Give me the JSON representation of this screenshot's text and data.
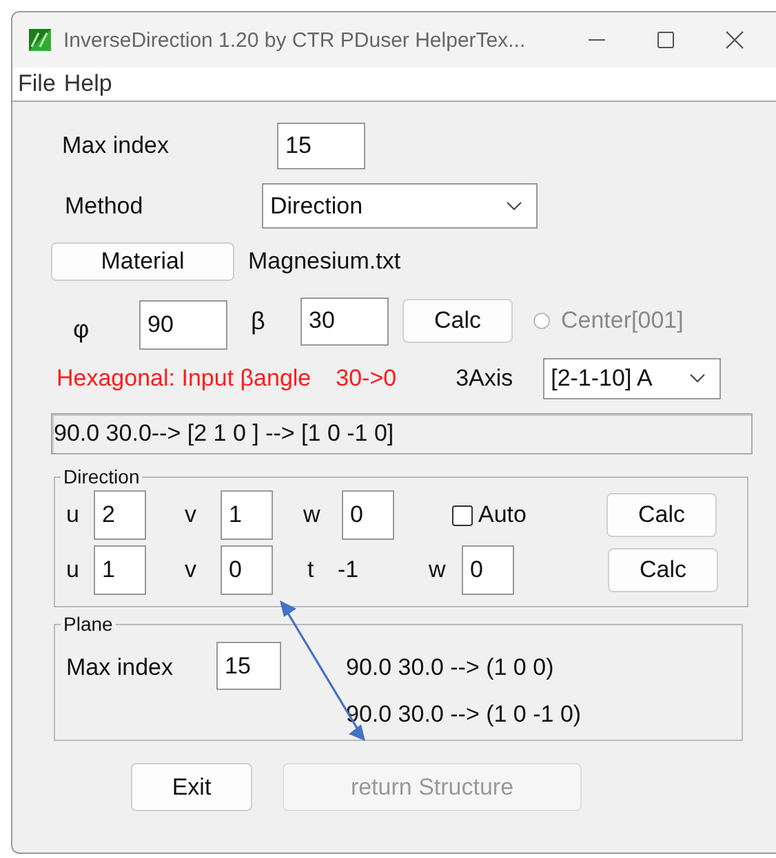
{
  "window": {
    "title": "InverseDirection 1.20 by CTR PDuser HelperTex..."
  },
  "menu": [
    "File",
    "Help"
  ],
  "max_index": {
    "label": "Max index",
    "value": "15"
  },
  "method": {
    "label": "Method",
    "value": "Direction"
  },
  "material": {
    "button": "Material",
    "file": "Magnesium.txt"
  },
  "angles": [
    {
      "label": "φ",
      "value": "90"
    },
    {
      "label": "β",
      "value": "30"
    }
  ],
  "calc_button": "Calc",
  "center": {
    "label": "Center[001]",
    "selected": false,
    "disabled": true
  },
  "warning": [
    "Hexagonal: Input βangle",
    "30->0"
  ],
  "axis": {
    "label": "3Axis",
    "value": "[2-1-10] A"
  },
  "result": "90.0 30.0--> [2 1 0 ] --> [1 0 -1 0]",
  "direction": {
    "title": "Direction",
    "rows": [
      {
        "fields": [
          {
            "kind": "input",
            "label": "u",
            "value": "2"
          },
          {
            "kind": "input",
            "label": "v",
            "value": "1"
          },
          {
            "kind": "input",
            "label": "w",
            "value": "0"
          }
        ],
        "auto": {
          "label": "Auto",
          "checked": false
        },
        "button": "Calc"
      },
      {
        "fields": [
          {
            "kind": "input",
            "label": "u",
            "value": "1"
          },
          {
            "kind": "input",
            "label": "v",
            "value": "0"
          },
          {
            "kind": "readout",
            "label": "t",
            "value": "-1"
          },
          {
            "kind": "input",
            "label": "w",
            "value": "0"
          }
        ],
        "button": "Calc"
      }
    ]
  },
  "plane": {
    "title": "Plane",
    "max_index": {
      "label": "Max index",
      "value": "15"
    },
    "results": [
      "90.0 30.0 --> (1 0 0)",
      "90.0 30.0 --> (1 0 -1 0)"
    ]
  },
  "buttons": [
    {
      "label": "Exit",
      "disabled": false
    },
    {
      "label": "return Structure",
      "disabled": true
    }
  ]
}
